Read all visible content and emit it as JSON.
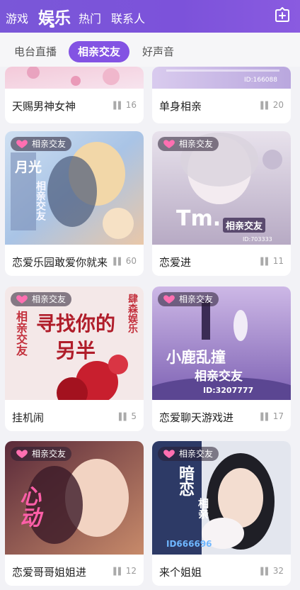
{
  "topnav": {
    "tabs": [
      "游戏",
      "娱乐",
      "热门",
      "联系人"
    ],
    "active": "娱乐"
  },
  "subtabs": [
    "电台直播",
    "相亲交友",
    "好声音"
  ],
  "badge_label": "相亲交友",
  "cards": [
    {
      "title": "天赐男神女神",
      "count": "16"
    },
    {
      "title": "单身相亲",
      "count": "20",
      "image_text": "ID:166088"
    },
    {
      "title": "恋爱乐园敢爱你就来",
      "count": "60",
      "image_text": [
        "月光",
        "相亲交友"
      ]
    },
    {
      "title": "恋爱进",
      "count": "11",
      "image_text": [
        "Tm.",
        "相亲交友",
        "ID:703333"
      ]
    },
    {
      "title": "挂机闹",
      "count": "5",
      "image_text": [
        "寻找你的另半",
        "相亲交友",
        "肆森娱乐"
      ]
    },
    {
      "title": "恋爱聊天游戏进",
      "count": "17",
      "image_text": [
        "小鹿乱撞",
        "相亲交友",
        "ID:3207777"
      ]
    },
    {
      "title": "恋爱哥哥姐姐进",
      "count": "12",
      "image_text": "心动"
    },
    {
      "title": "来个姐姐",
      "count": "32",
      "image_text": [
        "暗恋",
        "相亲",
        "ID666696"
      ]
    }
  ],
  "colors": {
    "nav": "#7c52da",
    "accent": "#8353e3"
  },
  "icons": {
    "add": "plus-box-icon",
    "badge": "heart-icon",
    "count": "signal-bars-icon"
  }
}
